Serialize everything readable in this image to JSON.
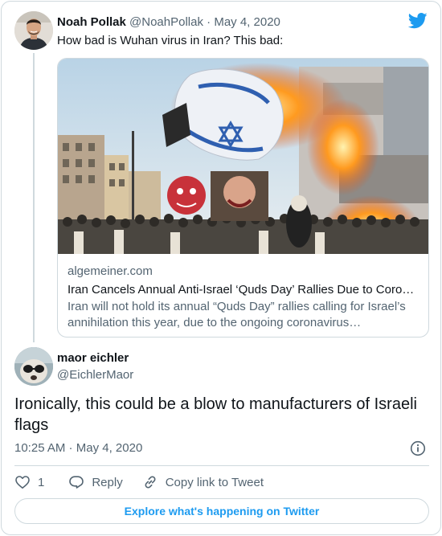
{
  "parent_tweet": {
    "author_name": "Noah Pollak",
    "handle": "@NoahPollak",
    "separator": " · ",
    "date": "May 4, 2020",
    "text": "How bad is Wuhan virus in Iran? This bad:",
    "link_card": {
      "domain": "algemeiner.com",
      "title": "Iran Cancels Annual Anti-Israel ‘Quds Day’ Rallies Due to Coro…",
      "description": "Iran will not hold its annual “Quds Day” rallies calling for Israel’s annihilation this year, due to the ongoing coronavirus…"
    }
  },
  "tweet": {
    "author_name": "maor eichler",
    "handle": "@EichlerMaor",
    "text": "Ironically, this could be a blow to manufacturers of Israeli flags",
    "time": "10:25 AM",
    "separator": " · ",
    "date": "May 4, 2020"
  },
  "actions": {
    "like_count": "1",
    "reply_label": "Reply",
    "copy_link_label": "Copy link to Tweet"
  },
  "explore_label": "Explore what's happening on Twitter",
  "colors": {
    "accent": "#1d9bf0",
    "text_primary": "#0f1419",
    "text_secondary": "#536471",
    "border": "#cfd9de"
  },
  "icons": [
    "twitter-bird-icon",
    "info-icon",
    "heart-icon",
    "reply-icon",
    "link-icon"
  ]
}
